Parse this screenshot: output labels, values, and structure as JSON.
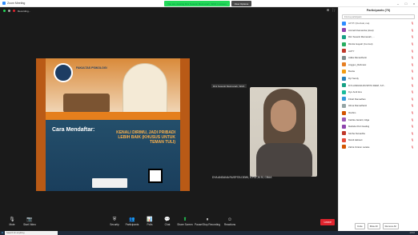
{
  "window": {
    "title": "Zoom Meeting"
  },
  "share_bar": {
    "message": "You are viewing Rini Susanti Meimanah, SKM.'s screen",
    "options": "View Options"
  },
  "meeting": {
    "recording": "Recording..."
  },
  "poster": {
    "title": "FAKULTAS PSIKOLOGI",
    "cara_label": "Cara Mendaftar:",
    "kenali": "KENALI DIRIMU, JADI PRIBADI LEBIH BAIK (KHUSUS UNTUK TEMAN TULI)"
  },
  "speaker": {
    "label": "Rini Susanti Meimanah, SKM.",
    "name": "DYA ANDANA RUSPITA DEWI, S.PSI.,M.Si, CBAA"
  },
  "controls": [
    {
      "label": "Mute",
      "icon": "mic"
    },
    {
      "label": "Start Video",
      "icon": "camera"
    },
    {
      "label": "Security",
      "icon": "shield"
    },
    {
      "label": "Participants",
      "icon": "people"
    },
    {
      "label": "Polls",
      "icon": "chart"
    },
    {
      "label": "Chat",
      "icon": "chat"
    },
    {
      "label": "Share Screen",
      "icon": "share"
    },
    {
      "label": "Pause/Stop Recording",
      "icon": "record"
    },
    {
      "label": "Reactions",
      "icon": "smile"
    }
  ],
  "end_button": "Leave",
  "panel": {
    "title": "Participants (70)",
    "search": "Find a participant",
    "participants": [
      {
        "name": "A P P I (Co-host, me)",
        "color": "#2d8cff"
      },
      {
        "name": "Aminah Kamaruba (Host)",
        "color": "#8e44ad"
      },
      {
        "name": "Rini Susanti Meimanah, ...",
        "color": "#16a085"
      },
      {
        "name": "Rindra Gayatri (Co-host)",
        "color": "#27ae60"
      },
      {
        "name": "AUTY",
        "color": "#c0392b"
      },
      {
        "name": "Adika Ramadhanti",
        "color": "#7f8c8d"
      },
      {
        "name": "Anggun_Rahmasi",
        "color": "#e67e22"
      },
      {
        "name": "Bonita",
        "color": "#f39c12"
      },
      {
        "name": "Dyt Sendy",
        "color": "#2980b9"
      },
      {
        "name": "DYA ANDANA RUSPITA DEWI, S.P...",
        "color": "#16a085"
      },
      {
        "name": "Dyo Andi Ana",
        "color": "#1abc9c"
      },
      {
        "name": "Fitrah Ramadhan",
        "color": "#3498db"
      },
      {
        "name": "Hilma Ramadhanti",
        "color": "#95a5a6"
      },
      {
        "name": "Ibrahim",
        "color": "#d35400"
      },
      {
        "name": "Kartika Janiarti, Aliga",
        "color": "#9b59b6"
      },
      {
        "name": "Melinda Putri Gading",
        "color": "#8e44ad"
      },
      {
        "name": "Sintha Nursadha",
        "color": "#c0392b"
      },
      {
        "name": "Mardi Habsari",
        "color": "#e74c3c"
      },
      {
        "name": "Zahra Izzatun Laraite",
        "color": "#d35400"
      }
    ],
    "footer": [
      "Invite",
      "Mute All",
      "Remove All"
    ]
  },
  "taskbar": {
    "search": "Search for anything",
    "clock": "10:16"
  }
}
